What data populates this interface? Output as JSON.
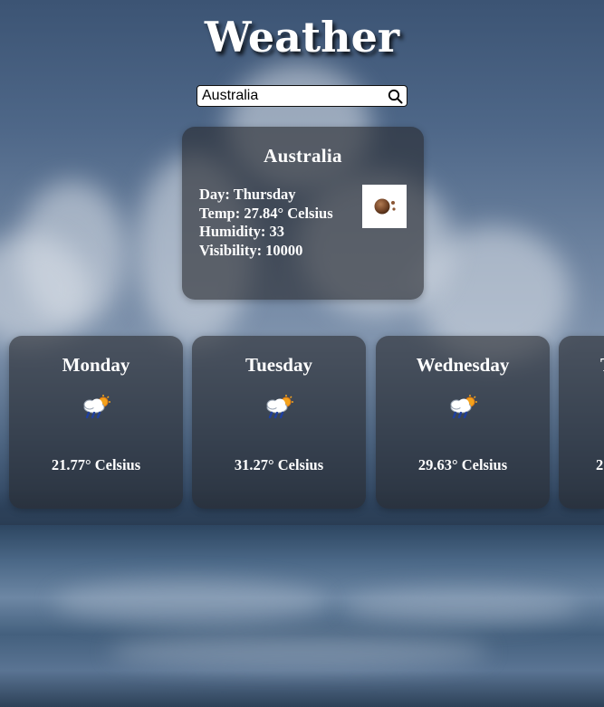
{
  "app": {
    "title": "Weather"
  },
  "search": {
    "value": "Australia",
    "icon": "search-icon"
  },
  "current": {
    "city": "Australia",
    "day_line": "Day: Thursday",
    "temp_line": "Temp: 27.84° Celsius",
    "humidity_line": "Humidity: 33",
    "visibility_line": "Visibility: 10000",
    "icon": "overcast-icon"
  },
  "forecast": [
    {
      "day": "Monday",
      "temp": "21.77° Celsius",
      "icon": "rain-sun-icon"
    },
    {
      "day": "Tuesday",
      "temp": "31.27° Celsius",
      "icon": "rain-sun-icon"
    },
    {
      "day": "Wednesday",
      "temp": "29.63° Celsius",
      "icon": "rain-sun-icon"
    },
    {
      "day": "T",
      "temp": "2",
      "icon": "rain-sun-icon"
    }
  ],
  "colors": {
    "card_bg": "#2a2c2e",
    "text": "#ffffff",
    "sun": "#f4a21c",
    "rain": "#1f3f9e"
  }
}
